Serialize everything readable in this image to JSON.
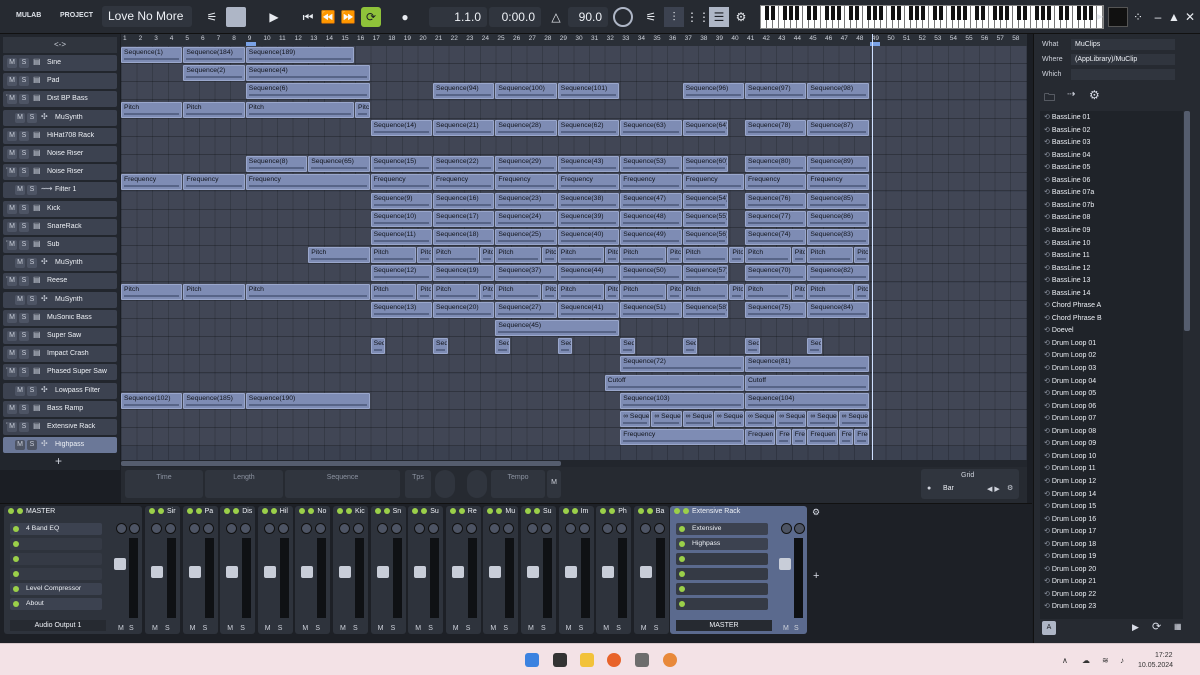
{
  "app": {
    "menu_mulab": "MULAB",
    "menu_project": "PROJECT",
    "project_title": "Love No More",
    "position": "1.1.0",
    "time": "0:00.0",
    "tempo": "90.0"
  },
  "tracklist": {
    "header": "<->",
    "add": "+",
    "tracks": [
      {
        "name": "Sine",
        "arrow": "",
        "indent": 0,
        "icon": "list-icon"
      },
      {
        "name": "Pad",
        "arrow": "",
        "indent": 0,
        "icon": "list-icon"
      },
      {
        "name": "Dist BP Bass",
        "arrow": "▼",
        "indent": 0,
        "icon": "list-icon"
      },
      {
        "name": "MuSynth",
        "arrow": "",
        "indent": 1,
        "icon": "synth-icon"
      },
      {
        "name": "HiHat708 Rack",
        "arrow": "",
        "indent": 0,
        "icon": "list-icon"
      },
      {
        "name": "Noise Riser",
        "arrow": "",
        "indent": 0,
        "icon": "list-icon"
      },
      {
        "name": "Noise Riser",
        "arrow": "▼",
        "indent": 0,
        "icon": "list-icon"
      },
      {
        "name": "Filter 1",
        "arrow": "",
        "indent": 1,
        "icon": "filter-icon"
      },
      {
        "name": "Kick",
        "arrow": "",
        "indent": 0,
        "icon": "list-icon"
      },
      {
        "name": "SnareRack",
        "arrow": "",
        "indent": 0,
        "icon": "list-icon"
      },
      {
        "name": "Sub",
        "arrow": "▼",
        "indent": 0,
        "icon": "list-icon"
      },
      {
        "name": "MuSynth",
        "arrow": "",
        "indent": 1,
        "icon": "synth-icon"
      },
      {
        "name": "Reese",
        "arrow": "▼",
        "indent": 0,
        "icon": "list-icon"
      },
      {
        "name": "MuSynth",
        "arrow": "",
        "indent": 1,
        "icon": "synth-icon"
      },
      {
        "name": "MuSonic Bass",
        "arrow": "",
        "indent": 0,
        "icon": "list-icon"
      },
      {
        "name": "Super Saw",
        "arrow": "",
        "indent": 0,
        "icon": "list-icon"
      },
      {
        "name": "Impact Crash",
        "arrow": "",
        "indent": 0,
        "icon": "list-icon"
      },
      {
        "name": "Phased Super Saw",
        "arrow": "▼",
        "indent": 0,
        "icon": "list-icon"
      },
      {
        "name": "Lowpass Filter",
        "arrow": "",
        "indent": 1,
        "icon": "synth-icon"
      },
      {
        "name": "Bass Ramp",
        "arrow": "",
        "indent": 0,
        "icon": "list-icon"
      },
      {
        "name": "Extensive Rack",
        "arrow": "▼",
        "indent": 0,
        "icon": "list-icon"
      },
      {
        "name": "Highpass",
        "arrow": "",
        "indent": 1,
        "icon": "synth-icon",
        "selected": true
      }
    ]
  },
  "ruler": {
    "bars": [
      "1",
      "2",
      "3",
      "4",
      "5",
      "6",
      "7",
      "8",
      "9",
      "10",
      "11",
      "12",
      "13",
      "14",
      "15",
      "16",
      "17",
      "18",
      "19",
      "20",
      "21",
      "22",
      "23",
      "24",
      "25",
      "26",
      "27",
      "28",
      "29",
      "30",
      "31",
      "32",
      "33",
      "34",
      "35",
      "36",
      "37",
      "38",
      "39",
      "40",
      "41",
      "42",
      "43",
      "44",
      "45",
      "46",
      "47",
      "48",
      "49",
      "50",
      "51",
      "52",
      "53",
      "54",
      "55",
      "56",
      "57",
      "58"
    ],
    "loop_start": "9",
    "loop_end": "49"
  },
  "clips": [
    {
      "lane": 0,
      "bar": 1,
      "len": 4,
      "label": "Sequence(1)"
    },
    {
      "lane": 0,
      "bar": 5,
      "len": 4,
      "label": "Sequence(184)"
    },
    {
      "lane": 0,
      "bar": 9,
      "len": 7,
      "label": "Sequence(189)"
    },
    {
      "lane": 1,
      "bar": 5,
      "len": 4,
      "label": "Sequence(2)"
    },
    {
      "lane": 1,
      "bar": 9,
      "len": 8,
      "label": "Sequence(4)"
    },
    {
      "lane": 2,
      "bar": 9,
      "len": 8,
      "label": "Sequence(6)"
    },
    {
      "lane": 2,
      "bar": 21,
      "len": 4,
      "label": "Sequence(94)"
    },
    {
      "lane": 2,
      "bar": 25,
      "len": 4,
      "label": "Sequence(100)"
    },
    {
      "lane": 2,
      "bar": 29,
      "len": 4,
      "label": "Sequence(101)"
    },
    {
      "lane": 2,
      "bar": 37,
      "len": 4,
      "label": "Sequence(96)"
    },
    {
      "lane": 2,
      "bar": 41,
      "len": 4,
      "label": "Sequence(97)"
    },
    {
      "lane": 2,
      "bar": 45,
      "len": 4,
      "label": "Sequence(98)"
    },
    {
      "lane": 3,
      "bar": 1,
      "len": 4,
      "label": "Pitch"
    },
    {
      "lane": 3,
      "bar": 5,
      "len": 4,
      "label": "Pitch"
    },
    {
      "lane": 3,
      "bar": 9,
      "len": 7,
      "label": "Pitch"
    },
    {
      "lane": 3,
      "bar": 16,
      "len": 1,
      "label": "Pitc"
    },
    {
      "lane": 4,
      "bar": 17,
      "len": 4,
      "label": "Sequence(14)"
    },
    {
      "lane": 4,
      "bar": 21,
      "len": 4,
      "label": "Sequence(21)"
    },
    {
      "lane": 4,
      "bar": 25,
      "len": 4,
      "label": "Sequence(28)"
    },
    {
      "lane": 4,
      "bar": 29,
      "len": 4,
      "label": "Sequence(62)"
    },
    {
      "lane": 4,
      "bar": 33,
      "len": 4,
      "label": "Sequence(63)"
    },
    {
      "lane": 4,
      "bar": 37,
      "len": 3,
      "label": "Sequence(64)"
    },
    {
      "lane": 4,
      "bar": 41,
      "len": 4,
      "label": "Sequence(78)"
    },
    {
      "lane": 4,
      "bar": 45,
      "len": 4,
      "label": "Sequence(87)"
    },
    {
      "lane": 6,
      "bar": 9,
      "len": 4,
      "label": "Sequence(8)"
    },
    {
      "lane": 6,
      "bar": 13,
      "len": 4,
      "label": "Sequence(65)"
    },
    {
      "lane": 6,
      "bar": 17,
      "len": 4,
      "label": "Sequence(15)"
    },
    {
      "lane": 6,
      "bar": 21,
      "len": 4,
      "label": "Sequence(22)"
    },
    {
      "lane": 6,
      "bar": 25,
      "len": 4,
      "label": "Sequence(29)"
    },
    {
      "lane": 6,
      "bar": 29,
      "len": 4,
      "label": "Sequence(43)"
    },
    {
      "lane": 6,
      "bar": 33,
      "len": 4,
      "label": "Sequence(53)"
    },
    {
      "lane": 6,
      "bar": 37,
      "len": 3,
      "label": "Sequence(60)"
    },
    {
      "lane": 6,
      "bar": 41,
      "len": 4,
      "label": "Sequence(80)"
    },
    {
      "lane": 6,
      "bar": 45,
      "len": 4,
      "label": "Sequence(89)"
    },
    {
      "lane": 7,
      "bar": 1,
      "len": 4,
      "label": "Frequency"
    },
    {
      "lane": 7,
      "bar": 5,
      "len": 4,
      "label": "Frequency"
    },
    {
      "lane": 7,
      "bar": 9,
      "len": 8,
      "label": "Frequency"
    },
    {
      "lane": 7,
      "bar": 17,
      "len": 4,
      "label": "Frequency"
    },
    {
      "lane": 7,
      "bar": 21,
      "len": 4,
      "label": "Frequency"
    },
    {
      "lane": 7,
      "bar": 25,
      "len": 4,
      "label": "Frequency"
    },
    {
      "lane": 7,
      "bar": 29,
      "len": 4,
      "label": "Frequency"
    },
    {
      "lane": 7,
      "bar": 33,
      "len": 4,
      "label": "Frequency"
    },
    {
      "lane": 7,
      "bar": 37,
      "len": 4,
      "label": "Frequency"
    },
    {
      "lane": 7,
      "bar": 41,
      "len": 4,
      "label": "Frequency"
    },
    {
      "lane": 7,
      "bar": 45,
      "len": 4,
      "label": "Frequency"
    },
    {
      "lane": 8,
      "bar": 17,
      "len": 4,
      "label": "Sequence(9)"
    },
    {
      "lane": 8,
      "bar": 21,
      "len": 4,
      "label": "Sequence(16)"
    },
    {
      "lane": 8,
      "bar": 25,
      "len": 4,
      "label": "Sequence(23)"
    },
    {
      "lane": 8,
      "bar": 29,
      "len": 4,
      "label": "Sequence(38)"
    },
    {
      "lane": 8,
      "bar": 33,
      "len": 4,
      "label": "Sequence(47)"
    },
    {
      "lane": 8,
      "bar": 37,
      "len": 3,
      "label": "Sequence(54)"
    },
    {
      "lane": 8,
      "bar": 41,
      "len": 4,
      "label": "Sequence(76)"
    },
    {
      "lane": 8,
      "bar": 45,
      "len": 4,
      "label": "Sequence(85)"
    },
    {
      "lane": 9,
      "bar": 17,
      "len": 4,
      "label": "Sequence(10)"
    },
    {
      "lane": 9,
      "bar": 21,
      "len": 4,
      "label": "Sequence(17)"
    },
    {
      "lane": 9,
      "bar": 25,
      "len": 4,
      "label": "Sequence(24)"
    },
    {
      "lane": 9,
      "bar": 29,
      "len": 4,
      "label": "Sequence(39)"
    },
    {
      "lane": 9,
      "bar": 33,
      "len": 4,
      "label": "Sequence(48)"
    },
    {
      "lane": 9,
      "bar": 37,
      "len": 3,
      "label": "Sequence(55)"
    },
    {
      "lane": 9,
      "bar": 41,
      "len": 4,
      "label": "Sequence(77)"
    },
    {
      "lane": 9,
      "bar": 45,
      "len": 4,
      "label": "Sequence(86)"
    },
    {
      "lane": 10,
      "bar": 17,
      "len": 4,
      "label": "Sequence(11)"
    },
    {
      "lane": 10,
      "bar": 21,
      "len": 4,
      "label": "Sequence(18)"
    },
    {
      "lane": 10,
      "bar": 25,
      "len": 4,
      "label": "Sequence(25)"
    },
    {
      "lane": 10,
      "bar": 29,
      "len": 4,
      "label": "Sequence(40)"
    },
    {
      "lane": 10,
      "bar": 33,
      "len": 4,
      "label": "Sequence(49)"
    },
    {
      "lane": 10,
      "bar": 37,
      "len": 3,
      "label": "Sequence(56)"
    },
    {
      "lane": 10,
      "bar": 41,
      "len": 4,
      "label": "Sequence(74)"
    },
    {
      "lane": 10,
      "bar": 45,
      "len": 4,
      "label": "Sequence(83)"
    },
    {
      "lane": 11,
      "bar": 13,
      "len": 4,
      "label": "Pitch"
    },
    {
      "lane": 11,
      "bar": 17,
      "len": 3,
      "label": "Pitch"
    },
    {
      "lane": 11,
      "bar": 20,
      "len": 1,
      "label": "Pitc"
    },
    {
      "lane": 11,
      "bar": 21,
      "len": 3,
      "label": "Pitch"
    },
    {
      "lane": 11,
      "bar": 24,
      "len": 1,
      "label": "Pitc"
    },
    {
      "lane": 11,
      "bar": 25,
      "len": 3,
      "label": "Pitch"
    },
    {
      "lane": 11,
      "bar": 28,
      "len": 1,
      "label": "Pitc"
    },
    {
      "lane": 11,
      "bar": 29,
      "len": 3,
      "label": "Pitch"
    },
    {
      "lane": 11,
      "bar": 32,
      "len": 1,
      "label": "Pitc"
    },
    {
      "lane": 11,
      "bar": 33,
      "len": 3,
      "label": "Pitch"
    },
    {
      "lane": 11,
      "bar": 36,
      "len": 1,
      "label": "Pitc"
    },
    {
      "lane": 11,
      "bar": 37,
      "len": 3,
      "label": "Pitch"
    },
    {
      "lane": 11,
      "bar": 40,
      "len": 1,
      "label": "Pitc"
    },
    {
      "lane": 11,
      "bar": 41,
      "len": 3,
      "label": "Pitch"
    },
    {
      "lane": 11,
      "bar": 44,
      "len": 1,
      "label": "Pitc"
    },
    {
      "lane": 11,
      "bar": 45,
      "len": 3,
      "label": "Pitch"
    },
    {
      "lane": 11,
      "bar": 48,
      "len": 1,
      "label": "Pitc"
    },
    {
      "lane": 12,
      "bar": 17,
      "len": 4,
      "label": "Sequence(12)"
    },
    {
      "lane": 12,
      "bar": 21,
      "len": 4,
      "label": "Sequence(19)"
    },
    {
      "lane": 12,
      "bar": 25,
      "len": 4,
      "label": "Sequence(37)"
    },
    {
      "lane": 12,
      "bar": 29,
      "len": 4,
      "label": "Sequence(44)"
    },
    {
      "lane": 12,
      "bar": 33,
      "len": 4,
      "label": "Sequence(50)"
    },
    {
      "lane": 12,
      "bar": 37,
      "len": 3,
      "label": "Sequence(57)"
    },
    {
      "lane": 12,
      "bar": 41,
      "len": 4,
      "label": "Sequence(70)"
    },
    {
      "lane": 12,
      "bar": 45,
      "len": 4,
      "label": "Sequence(82)"
    },
    {
      "lane": 13,
      "bar": 1,
      "len": 4,
      "label": "Pitch"
    },
    {
      "lane": 13,
      "bar": 5,
      "len": 4,
      "label": "Pitch"
    },
    {
      "lane": 13,
      "bar": 9,
      "len": 8,
      "label": "Pitch"
    },
    {
      "lane": 13,
      "bar": 17,
      "len": 3,
      "label": "Pitch"
    },
    {
      "lane": 13,
      "bar": 20,
      "len": 1,
      "label": "Pitc"
    },
    {
      "lane": 13,
      "bar": 21,
      "len": 3,
      "label": "Pitch"
    },
    {
      "lane": 13,
      "bar": 24,
      "len": 1,
      "label": "Pitc"
    },
    {
      "lane": 13,
      "bar": 25,
      "len": 3,
      "label": "Pitch"
    },
    {
      "lane": 13,
      "bar": 28,
      "len": 1,
      "label": "Pitc"
    },
    {
      "lane": 13,
      "bar": 29,
      "len": 3,
      "label": "Pitch"
    },
    {
      "lane": 13,
      "bar": 32,
      "len": 1,
      "label": "Pitc"
    },
    {
      "lane": 13,
      "bar": 33,
      "len": 3,
      "label": "Pitch"
    },
    {
      "lane": 13,
      "bar": 36,
      "len": 1,
      "label": "Pitc"
    },
    {
      "lane": 13,
      "bar": 37,
      "len": 3,
      "label": "Pitch"
    },
    {
      "lane": 13,
      "bar": 40,
      "len": 1,
      "label": "Pitc"
    },
    {
      "lane": 13,
      "bar": 41,
      "len": 3,
      "label": "Pitch"
    },
    {
      "lane": 13,
      "bar": 44,
      "len": 1,
      "label": "Pitc"
    },
    {
      "lane": 13,
      "bar": 45,
      "len": 3,
      "label": "Pitch"
    },
    {
      "lane": 13,
      "bar": 48,
      "len": 1,
      "label": "Pitc"
    },
    {
      "lane": 14,
      "bar": 17,
      "len": 4,
      "label": "Sequence(13)"
    },
    {
      "lane": 14,
      "bar": 21,
      "len": 4,
      "label": "Sequence(20)"
    },
    {
      "lane": 14,
      "bar": 25,
      "len": 4,
      "label": "Sequence(27)"
    },
    {
      "lane": 14,
      "bar": 29,
      "len": 4,
      "label": "Sequence(41)"
    },
    {
      "lane": 14,
      "bar": 33,
      "len": 4,
      "label": "Sequence(51)"
    },
    {
      "lane": 14,
      "bar": 37,
      "len": 3,
      "label": "Sequence(58)"
    },
    {
      "lane": 14,
      "bar": 41,
      "len": 4,
      "label": "Sequence(75)"
    },
    {
      "lane": 14,
      "bar": 45,
      "len": 4,
      "label": "Sequence(84)"
    },
    {
      "lane": 15,
      "bar": 25,
      "len": 8,
      "label": "Sequence(45)"
    },
    {
      "lane": 16,
      "bar": 17,
      "len": 1,
      "label": "Seq"
    },
    {
      "lane": 16,
      "bar": 21,
      "len": 1,
      "label": "Seq"
    },
    {
      "lane": 16,
      "bar": 25,
      "len": 1,
      "label": "Seq"
    },
    {
      "lane": 16,
      "bar": 29,
      "len": 1,
      "label": "Seq"
    },
    {
      "lane": 16,
      "bar": 33,
      "len": 1,
      "label": "Seq"
    },
    {
      "lane": 16,
      "bar": 37,
      "len": 1,
      "label": "Seq"
    },
    {
      "lane": 16,
      "bar": 41,
      "len": 1,
      "label": "Seq"
    },
    {
      "lane": 16,
      "bar": 45,
      "len": 1,
      "label": "Seq"
    },
    {
      "lane": 17,
      "bar": 33,
      "len": 8,
      "label": "Sequence(72)"
    },
    {
      "lane": 17,
      "bar": 41,
      "len": 8,
      "label": "Sequence(81)"
    },
    {
      "lane": 18,
      "bar": 32,
      "len": 9,
      "label": "Cutoff"
    },
    {
      "lane": 18,
      "bar": 41,
      "len": 8,
      "label": "Cutoff"
    },
    {
      "lane": 19,
      "bar": 1,
      "len": 4,
      "label": "Sequence(102)"
    },
    {
      "lane": 19,
      "bar": 5,
      "len": 4,
      "label": "Sequence(185)"
    },
    {
      "lane": 19,
      "bar": 9,
      "len": 8,
      "label": "Sequence(190)"
    },
    {
      "lane": 19,
      "bar": 33,
      "len": 8,
      "label": "Sequence(103)"
    },
    {
      "lane": 19,
      "bar": 41,
      "len": 8,
      "label": "Sequence(104)"
    },
    {
      "lane": 20,
      "bar": 33,
      "len": 2,
      "label": "∞ Seque"
    },
    {
      "lane": 20,
      "bar": 35,
      "len": 2,
      "label": "∞ Seque"
    },
    {
      "lane": 20,
      "bar": 37,
      "len": 2,
      "label": "∞ Seque"
    },
    {
      "lane": 20,
      "bar": 39,
      "len": 2,
      "label": "∞ Seque"
    },
    {
      "lane": 20,
      "bar": 41,
      "len": 2,
      "label": "∞ Seque"
    },
    {
      "lane": 20,
      "bar": 43,
      "len": 2,
      "label": "∞ Seque"
    },
    {
      "lane": 20,
      "bar": 45,
      "len": 2,
      "label": "∞ Seque"
    },
    {
      "lane": 20,
      "bar": 47,
      "len": 2,
      "label": "∞ Seque"
    },
    {
      "lane": 21,
      "bar": 33,
      "len": 8,
      "label": "Frequency"
    },
    {
      "lane": 21,
      "bar": 41,
      "len": 2,
      "label": "Frequen"
    },
    {
      "lane": 21,
      "bar": 43,
      "len": 1,
      "label": "Frec"
    },
    {
      "lane": 21,
      "bar": 44,
      "len": 1,
      "label": "Frec"
    },
    {
      "lane": 21,
      "bar": 45,
      "len": 2,
      "label": "Frequen"
    },
    {
      "lane": 21,
      "bar": 47,
      "len": 1,
      "label": "Frec"
    },
    {
      "lane": 21,
      "bar": 48,
      "len": 1,
      "label": "Frec"
    }
  ],
  "editor": {
    "time": "Time",
    "length": "Length",
    "sequence": "Sequence",
    "tps": "Tps",
    "tempo": "Tempo",
    "m": "M",
    "grid_label": "Grid",
    "grid_value": "Bar"
  },
  "mixer": {
    "master": {
      "name": "MASTER",
      "fx": [
        "4 Band EQ",
        "",
        "",
        "",
        "Level Compressor",
        "About"
      ],
      "output": "Audio Output 1"
    },
    "strips": [
      "Sir",
      "Pa",
      "Dis",
      "Hil",
      "No",
      "Kic",
      "Sn",
      "Su",
      "Re",
      "Mu",
      "Su",
      "Im",
      "Ph",
      "Ba"
    ],
    "rack": {
      "name": "Extensive Rack",
      "fx": [
        "Extensive",
        "Highpass",
        "",
        "",
        "",
        ""
      ],
      "output": "MASTER"
    },
    "m": "M",
    "s": "S",
    "add": "+"
  },
  "browser": {
    "what_label": "What",
    "what_value": "MuClips",
    "where_label": "Where",
    "where_value": "(AppLibrary)/MuClip",
    "which_label": "Which",
    "which_value": "",
    "files": [
      "BassLine 01",
      "BassLine 02",
      "BassLine 03",
      "BassLine 04",
      "BassLine 05",
      "BassLine 06",
      "BassLine 07a",
      "BassLine 07b",
      "BassLine 08",
      "BassLine 09",
      "BassLine 10",
      "BassLine 11",
      "BassLine 12",
      "BassLine 13",
      "BassLine 14",
      "Chord Phrase A",
      "Chord Phrase B",
      "Doevel",
      "Drum Loop 01",
      "Drum Loop 02",
      "Drum Loop 03",
      "Drum Loop 04",
      "Drum Loop 05",
      "Drum Loop 06",
      "Drum Loop 07",
      "Drum Loop 08",
      "Drum Loop 09",
      "Drum Loop 10",
      "Drum Loop 11",
      "Drum Loop 12",
      "Drum Loop 14",
      "Drum Loop 15",
      "Drum Loop 16",
      "Drum Loop 17",
      "Drum Loop 18",
      "Drum Loop 19",
      "Drum Loop 20",
      "Drum Loop 21",
      "Drum Loop 22",
      "Drum Loop 23"
    ],
    "a_button": "A"
  },
  "taskbar": {
    "time": "17:22",
    "date": "10.05.2024",
    "icons": [
      "start-icon",
      "taskview-icon",
      "explorer-icon",
      "firefox-icon",
      "app-icon",
      "mulab-icon"
    ]
  }
}
